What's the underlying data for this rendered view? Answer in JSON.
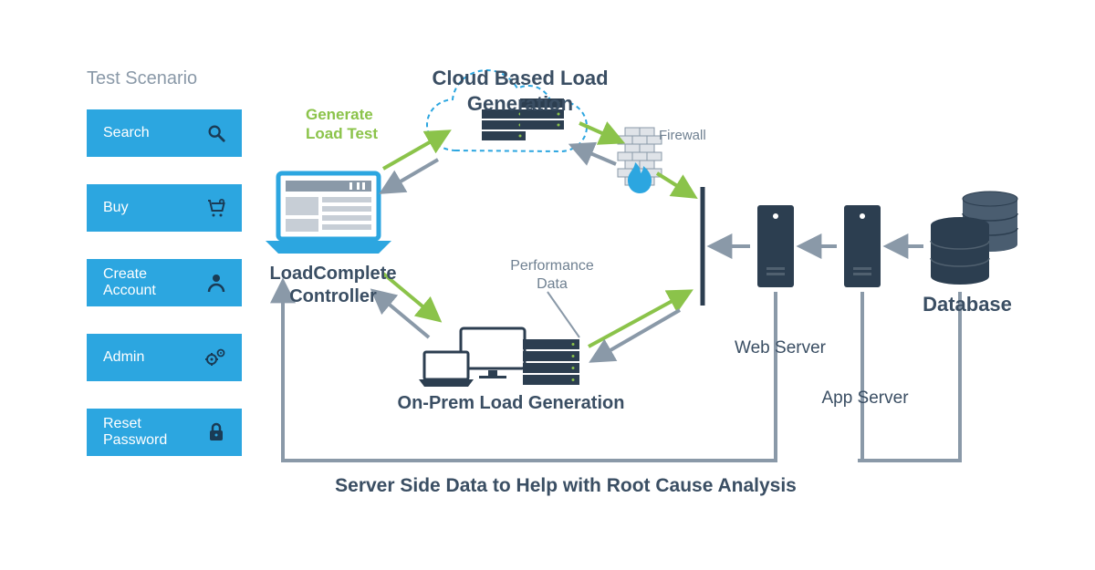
{
  "sidebar": {
    "title": "Test Scenario",
    "items": [
      {
        "label": "Search",
        "icon": "search-icon"
      },
      {
        "label": "Buy",
        "icon": "cart-icon"
      },
      {
        "label": "Create Account",
        "icon": "user-icon"
      },
      {
        "label": "Admin",
        "icon": "gears-icon"
      },
      {
        "label": "Reset Password",
        "icon": "lock-icon"
      }
    ]
  },
  "labels": {
    "cloud_gen": "Cloud Based Load Generation",
    "generate_load": "Generate Load Test",
    "controller": "LoadComplete Controller",
    "onprem": "On-Prem Load Generation",
    "perf_data": "Performance Data",
    "firewall": "Firewall",
    "web_server": "Web Server",
    "app_server": "App Server",
    "database": "Database",
    "footer": "Server Side Data to Help with Root Cause Analysis"
  },
  "colors": {
    "button": "#2ca6e0",
    "dark": "#2c3e50",
    "grey": "#8a99a8",
    "green": "#8bc34a"
  }
}
